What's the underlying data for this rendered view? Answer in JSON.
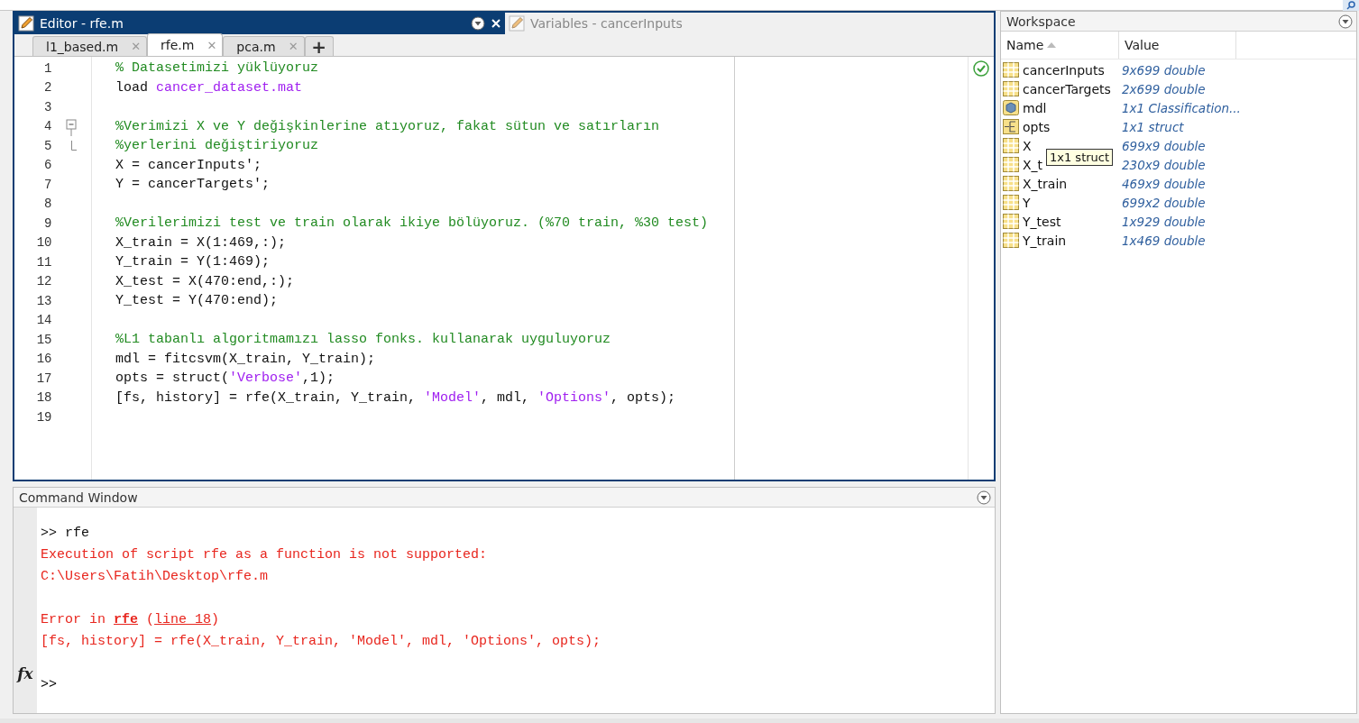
{
  "editor": {
    "title": "Editor - rfe.m",
    "other_panel_title": "Variables - cancerInputs",
    "tabs": [
      {
        "label": "l1_based.m",
        "close": "✕",
        "selected": false
      },
      {
        "label": "rfe.m",
        "close": "✕",
        "selected": true
      },
      {
        "label": "pca.m",
        "close": "✕",
        "selected": false
      }
    ],
    "new_tab": "+",
    "lines": [
      {
        "number": "1",
        "segments": [
          {
            "kind": "comment",
            "text": "% Datasetimizi yüklüyoruz"
          }
        ]
      },
      {
        "number": "2",
        "segments": [
          {
            "kind": "code",
            "text": "load "
          },
          {
            "kind": "string",
            "text": "cancer_dataset.mat"
          }
        ]
      },
      {
        "number": "3"
      },
      {
        "number": "4",
        "fold_start": true,
        "segments": [
          {
            "kind": "comment",
            "text": "%Verimizi X ve Y değişkinlerine atıyoruz, fakat sütun ve satırların"
          }
        ]
      },
      {
        "number": "5",
        "fold_end": true,
        "segments": [
          {
            "kind": "comment",
            "text": "%yerlerini değiştiriyoruz"
          }
        ]
      },
      {
        "number": "6",
        "segments": [
          {
            "kind": "code",
            "text": "X = cancerInputs';"
          }
        ]
      },
      {
        "number": "7",
        "segments": [
          {
            "kind": "code",
            "text": "Y = cancerTargets';"
          }
        ]
      },
      {
        "number": "8"
      },
      {
        "number": "9",
        "segments": [
          {
            "kind": "comment",
            "text": "%Verilerimizi test ve train olarak ikiye bölüyoruz. (%70 train, %30 test)"
          }
        ]
      },
      {
        "number": "10",
        "segments": [
          {
            "kind": "code",
            "text": "X_train = X(1:469,:);"
          }
        ]
      },
      {
        "number": "11",
        "segments": [
          {
            "kind": "code",
            "text": "Y_train = Y(1:469);"
          }
        ]
      },
      {
        "number": "12",
        "segments": [
          {
            "kind": "code",
            "text": "X_test = X(470:end,:);"
          }
        ]
      },
      {
        "number": "13",
        "segments": [
          {
            "kind": "code",
            "text": "Y_test = Y(470:end);"
          }
        ]
      },
      {
        "number": "14"
      },
      {
        "number": "15",
        "segments": [
          {
            "kind": "comment",
            "text": "%L1 tabanlı algoritmamızı lasso fonks. kullanarak uyguluyoruz"
          }
        ]
      },
      {
        "number": "16",
        "segments": [
          {
            "kind": "code",
            "text": "mdl = fitcsvm(X_train, Y_train);"
          }
        ]
      },
      {
        "number": "17",
        "segments": [
          {
            "kind": "code",
            "text": "opts = struct("
          },
          {
            "kind": "string",
            "text": "'Verbose'"
          },
          {
            "kind": "code",
            "text": ",1);"
          }
        ]
      },
      {
        "number": "18",
        "segments": [
          {
            "kind": "code",
            "text": "[fs, history] = rfe(X_train, Y_train, "
          },
          {
            "kind": "string",
            "text": "'Model'"
          },
          {
            "kind": "code",
            "text": ", mdl, "
          },
          {
            "kind": "string",
            "text": "'Options'"
          },
          {
            "kind": "code",
            "text": ", opts);"
          }
        ]
      },
      {
        "number": "19"
      }
    ]
  },
  "command_window": {
    "title": "Command Window",
    "lines": [
      {
        "segments": [
          {
            "kind": "input",
            "text": ">> rfe"
          }
        ]
      },
      {
        "segments": [
          {
            "kind": "error",
            "text": "Execution of script rfe as a function is not supported:"
          }
        ]
      },
      {
        "segments": [
          {
            "kind": "error",
            "text": "C:\\Users\\Fatih\\Desktop\\rfe.m"
          }
        ]
      },
      {
        "gap_before": true,
        "segments": [
          {
            "kind": "error",
            "text": "Error in "
          },
          {
            "kind": "bold_link",
            "text": "rfe"
          },
          {
            "kind": "error",
            "text": " ("
          },
          {
            "kind": "link",
            "text": "line 18"
          },
          {
            "kind": "error",
            "text": ")"
          }
        ]
      },
      {
        "segments": [
          {
            "kind": "error",
            "text": "[fs, history] = rfe(X_train, Y_train, 'Model', mdl, 'Options', opts);"
          }
        ]
      }
    ],
    "fx": "fx",
    "prompt": ">>"
  },
  "workspace": {
    "title": "Workspace",
    "columns": [
      "Name",
      "Value"
    ],
    "rows": [
      {
        "kind": "matrix",
        "name": "cancerInputs",
        "value": "9x699 double"
      },
      {
        "kind": "matrix",
        "name": "cancerTargets",
        "value": "2x699 double"
      },
      {
        "kind": "object",
        "name": "mdl",
        "value": "1x1 Classification..."
      },
      {
        "kind": "struct",
        "name": "opts",
        "value": "1x1 struct"
      },
      {
        "kind": "matrix",
        "name": "X",
        "value": "699x9 double"
      },
      {
        "kind": "matrix",
        "name": "X_t",
        "value": "230x9 double"
      },
      {
        "kind": "matrix",
        "name": "X_train",
        "value": "469x9 double"
      },
      {
        "kind": "matrix",
        "name": "Y",
        "value": "699x2 double"
      },
      {
        "kind": "matrix",
        "name": "Y_test",
        "value": "1x929 double"
      },
      {
        "kind": "matrix",
        "name": "Y_train",
        "value": "1x469 double"
      }
    ],
    "tooltip": "1x1 struct"
  }
}
